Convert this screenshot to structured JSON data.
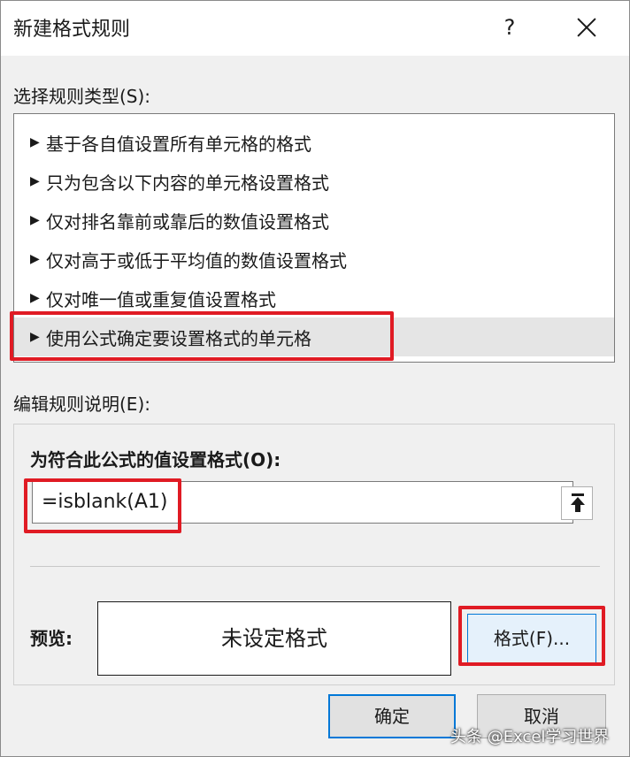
{
  "dialog": {
    "title": "新建格式规则",
    "help_label": "?"
  },
  "rule_types": {
    "label": "选择规则类型(S):",
    "items": [
      {
        "label": "基于各自值设置所有单元格的格式"
      },
      {
        "label": "只为包含以下内容的单元格设置格式"
      },
      {
        "label": "仅对排名靠前或靠后的数值设置格式"
      },
      {
        "label": "仅对高于或低于平均值的数值设置格式"
      },
      {
        "label": "仅对唯一值或重复值设置格式"
      },
      {
        "label": "使用公式确定要设置格式的单元格",
        "selected": true
      }
    ],
    "arrow_glyph": "▶"
  },
  "description": {
    "label": "编辑规则说明(E):",
    "formula_label": "为符合此公式的值设置格式(O):",
    "formula_value": "=isblank(A1)",
    "preview_label": "预览:",
    "preview_text": "未设定格式",
    "format_button": "格式(F)..."
  },
  "buttons": {
    "ok": "确定",
    "cancel": "取消"
  },
  "watermark": "头条 @Excel学习世界",
  "colors": {
    "highlight_red": "#e01b24",
    "accent_blue": "#0078d7",
    "selected_row": "#e5e5e5"
  },
  "icons": {
    "collapse": "arrow-up-bar-icon",
    "close": "close-icon"
  }
}
